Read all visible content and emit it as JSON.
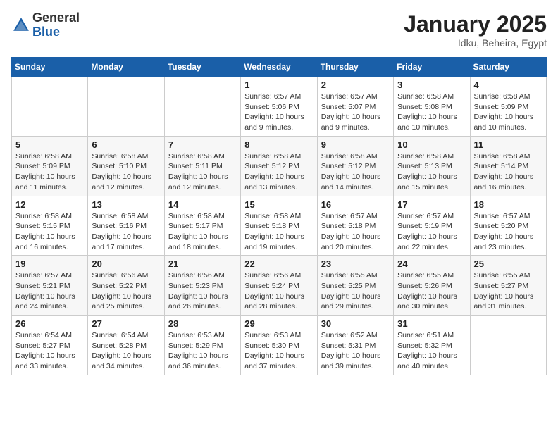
{
  "header": {
    "logo_line1": "General",
    "logo_line2": "Blue",
    "title": "January 2025",
    "subtitle": "Idku, Beheira, Egypt"
  },
  "weekdays": [
    "Sunday",
    "Monday",
    "Tuesday",
    "Wednesday",
    "Thursday",
    "Friday",
    "Saturday"
  ],
  "weeks": [
    [
      {
        "day": "",
        "info": ""
      },
      {
        "day": "",
        "info": ""
      },
      {
        "day": "",
        "info": ""
      },
      {
        "day": "1",
        "info": "Sunrise: 6:57 AM\nSunset: 5:06 PM\nDaylight: 10 hours\nand 9 minutes."
      },
      {
        "day": "2",
        "info": "Sunrise: 6:57 AM\nSunset: 5:07 PM\nDaylight: 10 hours\nand 9 minutes."
      },
      {
        "day": "3",
        "info": "Sunrise: 6:58 AM\nSunset: 5:08 PM\nDaylight: 10 hours\nand 10 minutes."
      },
      {
        "day": "4",
        "info": "Sunrise: 6:58 AM\nSunset: 5:09 PM\nDaylight: 10 hours\nand 10 minutes."
      }
    ],
    [
      {
        "day": "5",
        "info": "Sunrise: 6:58 AM\nSunset: 5:09 PM\nDaylight: 10 hours\nand 11 minutes."
      },
      {
        "day": "6",
        "info": "Sunrise: 6:58 AM\nSunset: 5:10 PM\nDaylight: 10 hours\nand 12 minutes."
      },
      {
        "day": "7",
        "info": "Sunrise: 6:58 AM\nSunset: 5:11 PM\nDaylight: 10 hours\nand 12 minutes."
      },
      {
        "day": "8",
        "info": "Sunrise: 6:58 AM\nSunset: 5:12 PM\nDaylight: 10 hours\nand 13 minutes."
      },
      {
        "day": "9",
        "info": "Sunrise: 6:58 AM\nSunset: 5:12 PM\nDaylight: 10 hours\nand 14 minutes."
      },
      {
        "day": "10",
        "info": "Sunrise: 6:58 AM\nSunset: 5:13 PM\nDaylight: 10 hours\nand 15 minutes."
      },
      {
        "day": "11",
        "info": "Sunrise: 6:58 AM\nSunset: 5:14 PM\nDaylight: 10 hours\nand 16 minutes."
      }
    ],
    [
      {
        "day": "12",
        "info": "Sunrise: 6:58 AM\nSunset: 5:15 PM\nDaylight: 10 hours\nand 16 minutes."
      },
      {
        "day": "13",
        "info": "Sunrise: 6:58 AM\nSunset: 5:16 PM\nDaylight: 10 hours\nand 17 minutes."
      },
      {
        "day": "14",
        "info": "Sunrise: 6:58 AM\nSunset: 5:17 PM\nDaylight: 10 hours\nand 18 minutes."
      },
      {
        "day": "15",
        "info": "Sunrise: 6:58 AM\nSunset: 5:18 PM\nDaylight: 10 hours\nand 19 minutes."
      },
      {
        "day": "16",
        "info": "Sunrise: 6:57 AM\nSunset: 5:18 PM\nDaylight: 10 hours\nand 20 minutes."
      },
      {
        "day": "17",
        "info": "Sunrise: 6:57 AM\nSunset: 5:19 PM\nDaylight: 10 hours\nand 22 minutes."
      },
      {
        "day": "18",
        "info": "Sunrise: 6:57 AM\nSunset: 5:20 PM\nDaylight: 10 hours\nand 23 minutes."
      }
    ],
    [
      {
        "day": "19",
        "info": "Sunrise: 6:57 AM\nSunset: 5:21 PM\nDaylight: 10 hours\nand 24 minutes."
      },
      {
        "day": "20",
        "info": "Sunrise: 6:56 AM\nSunset: 5:22 PM\nDaylight: 10 hours\nand 25 minutes."
      },
      {
        "day": "21",
        "info": "Sunrise: 6:56 AM\nSunset: 5:23 PM\nDaylight: 10 hours\nand 26 minutes."
      },
      {
        "day": "22",
        "info": "Sunrise: 6:56 AM\nSunset: 5:24 PM\nDaylight: 10 hours\nand 28 minutes."
      },
      {
        "day": "23",
        "info": "Sunrise: 6:55 AM\nSunset: 5:25 PM\nDaylight: 10 hours\nand 29 minutes."
      },
      {
        "day": "24",
        "info": "Sunrise: 6:55 AM\nSunset: 5:26 PM\nDaylight: 10 hours\nand 30 minutes."
      },
      {
        "day": "25",
        "info": "Sunrise: 6:55 AM\nSunset: 5:27 PM\nDaylight: 10 hours\nand 31 minutes."
      }
    ],
    [
      {
        "day": "26",
        "info": "Sunrise: 6:54 AM\nSunset: 5:27 PM\nDaylight: 10 hours\nand 33 minutes."
      },
      {
        "day": "27",
        "info": "Sunrise: 6:54 AM\nSunset: 5:28 PM\nDaylight: 10 hours\nand 34 minutes."
      },
      {
        "day": "28",
        "info": "Sunrise: 6:53 AM\nSunset: 5:29 PM\nDaylight: 10 hours\nand 36 minutes."
      },
      {
        "day": "29",
        "info": "Sunrise: 6:53 AM\nSunset: 5:30 PM\nDaylight: 10 hours\nand 37 minutes."
      },
      {
        "day": "30",
        "info": "Sunrise: 6:52 AM\nSunset: 5:31 PM\nDaylight: 10 hours\nand 39 minutes."
      },
      {
        "day": "31",
        "info": "Sunrise: 6:51 AM\nSunset: 5:32 PM\nDaylight: 10 hours\nand 40 minutes."
      },
      {
        "day": "",
        "info": ""
      }
    ]
  ]
}
